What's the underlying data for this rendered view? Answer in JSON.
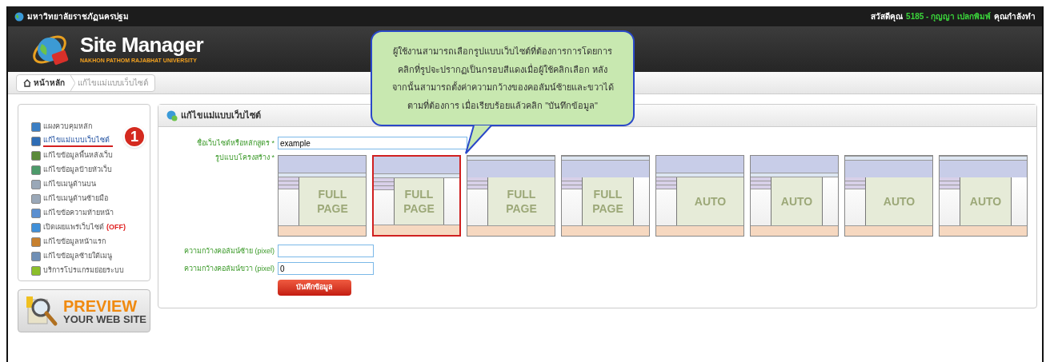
{
  "top_bar": {
    "university": "มหาวิทยาลัยราชภัฏนครปฐม",
    "greeting": "สวัสดีคุณ",
    "user": "5185 - กุญญา เปลกพิมพ์",
    "status": "คุณกำลังทำ"
  },
  "header": {
    "title": "Site Manager",
    "subtitle": "NAKHON PATHOM RAJABHAT UNIVERSITY"
  },
  "breadcrumb": [
    {
      "label": "หน้าหลัก",
      "kind": "home"
    },
    {
      "label": "แก้ไขแม่แบบเว็บไซต์",
      "kind": "page"
    }
  ],
  "sidebar": {
    "items": [
      {
        "label": "แผงควบคุมหลัก",
        "selected": false,
        "color": "#3b7fc4"
      },
      {
        "label": "แก้ไขแม่แบบเว็บไซต์",
        "selected": true,
        "color": "#2f6db5"
      },
      {
        "label": "แก้ไขข้อมูลพื้นหลังเว็บ",
        "selected": false,
        "color": "#5a8a3a"
      },
      {
        "label": "แก้ไขข้อมูลป้ายหัวเว็บ",
        "selected": false,
        "color": "#4d9a6a"
      },
      {
        "label": "แก้ไขเมนูด้านบน",
        "selected": false,
        "color": "#9aa8b8"
      },
      {
        "label": "แก้ไขเมนูด้านซ้ายมือ",
        "selected": false,
        "color": "#9aa8b8"
      },
      {
        "label": "แก้ไขข้อความท้ายหน้า",
        "selected": false,
        "color": "#5b8fd0"
      },
      {
        "label": "เปิดเผยแพร่เว็บไซต์",
        "badge": "(OFF)",
        "selected": false,
        "color": "#3f8fd8"
      },
      {
        "label": "แก้ไขข้อมูลหน้าแรก",
        "selected": false,
        "color": "#c7802e"
      },
      {
        "label": "แก้ไขข้อมูลซ้ายใต้เมนู",
        "selected": false,
        "color": "#6f8fb5"
      },
      {
        "label": "บริการโปรแกรมย่อยระบบ",
        "selected": false,
        "color": "#8cbf2a"
      }
    ],
    "step": "1"
  },
  "preview": {
    "title": "PREVIEW",
    "subtitle": "YOUR WEB SITE"
  },
  "panel": {
    "title": "แก้ไขแม่แบบเว็บไซต์",
    "site_name": {
      "label": "ชื่อเว็บไซต์หรือหลักสูตร *",
      "value": "example"
    },
    "layout": {
      "label": "รูปแบบโครงสร้าง *",
      "options": [
        {
          "text": "FULL PAGE",
          "kind": "strip-below",
          "right_column": false,
          "selected": false
        },
        {
          "text": "FULL PAGE",
          "kind": "strip-below",
          "right_column": true,
          "selected": true
        },
        {
          "text": "FULL PAGE",
          "kind": "strip-above",
          "right_column": false,
          "selected": false
        },
        {
          "text": "FULL PAGE",
          "kind": "strip-above",
          "right_column": true,
          "selected": false
        },
        {
          "text": "AUTO",
          "kind": "strip-below",
          "right_column": false,
          "selected": false
        },
        {
          "text": "AUTO",
          "kind": "strip-below",
          "right_column": true,
          "selected": false
        },
        {
          "text": "AUTO",
          "kind": "strip-above",
          "right_column": false,
          "selected": false
        },
        {
          "text": "AUTO",
          "kind": "strip-above",
          "right_column": true,
          "selected": false
        }
      ]
    },
    "left_width": {
      "label": "ความกว้างคอลัมน์ซ้าย (pixel)"
    },
    "right_width": {
      "label": "ความกว้างคอลัมน์ขวา (pixel)",
      "value": "0"
    },
    "save_button": "บันทึกข้อมูล"
  },
  "callout": {
    "lines": [
      "ผู้ใช้งานสามารถเลือกรูปแบบเว็บไซต์ที่ต้องการการโดยการ",
      "คลิกที่รูปจะปรากฏเป็นกรอบสีแดงเมื่อผู้ใช้คลิกเลือก หลัง",
      "จากนั้นสามารถตั้งค่าความกว้างของคอลัมน์ซ้ายและขวาได้",
      "ตามที่ต้องการ เมื่อเรียบร้อยแล้วคลิก \"บันทึกข้อมูล\""
    ]
  }
}
